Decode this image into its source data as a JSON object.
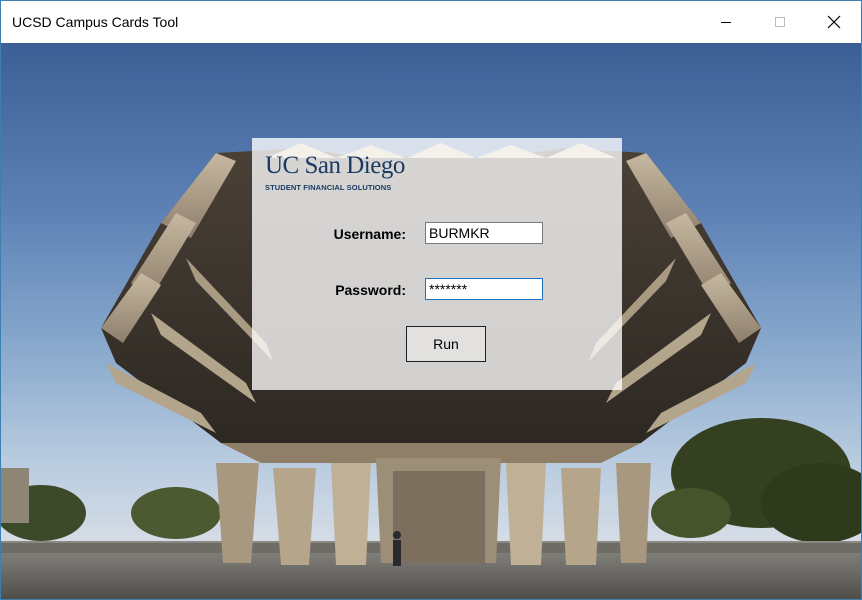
{
  "window": {
    "title": "UCSD Campus Cards Tool",
    "controls": {
      "minimize": "minimize-icon",
      "maximize": "maximize-icon",
      "close": "close-icon"
    }
  },
  "logo": {
    "name": "UC San Diego",
    "subtitle": "STUDENT FINANCIAL SOLUTIONS"
  },
  "form": {
    "username_label": "Username:",
    "username_value": "BURMKR",
    "password_label": "Password:",
    "password_value": "*******",
    "run_label": "Run"
  },
  "colors": {
    "window_border": "#3c7fb1",
    "focus_border": "#1d6fc2",
    "logo_text": "#1b3a63"
  }
}
